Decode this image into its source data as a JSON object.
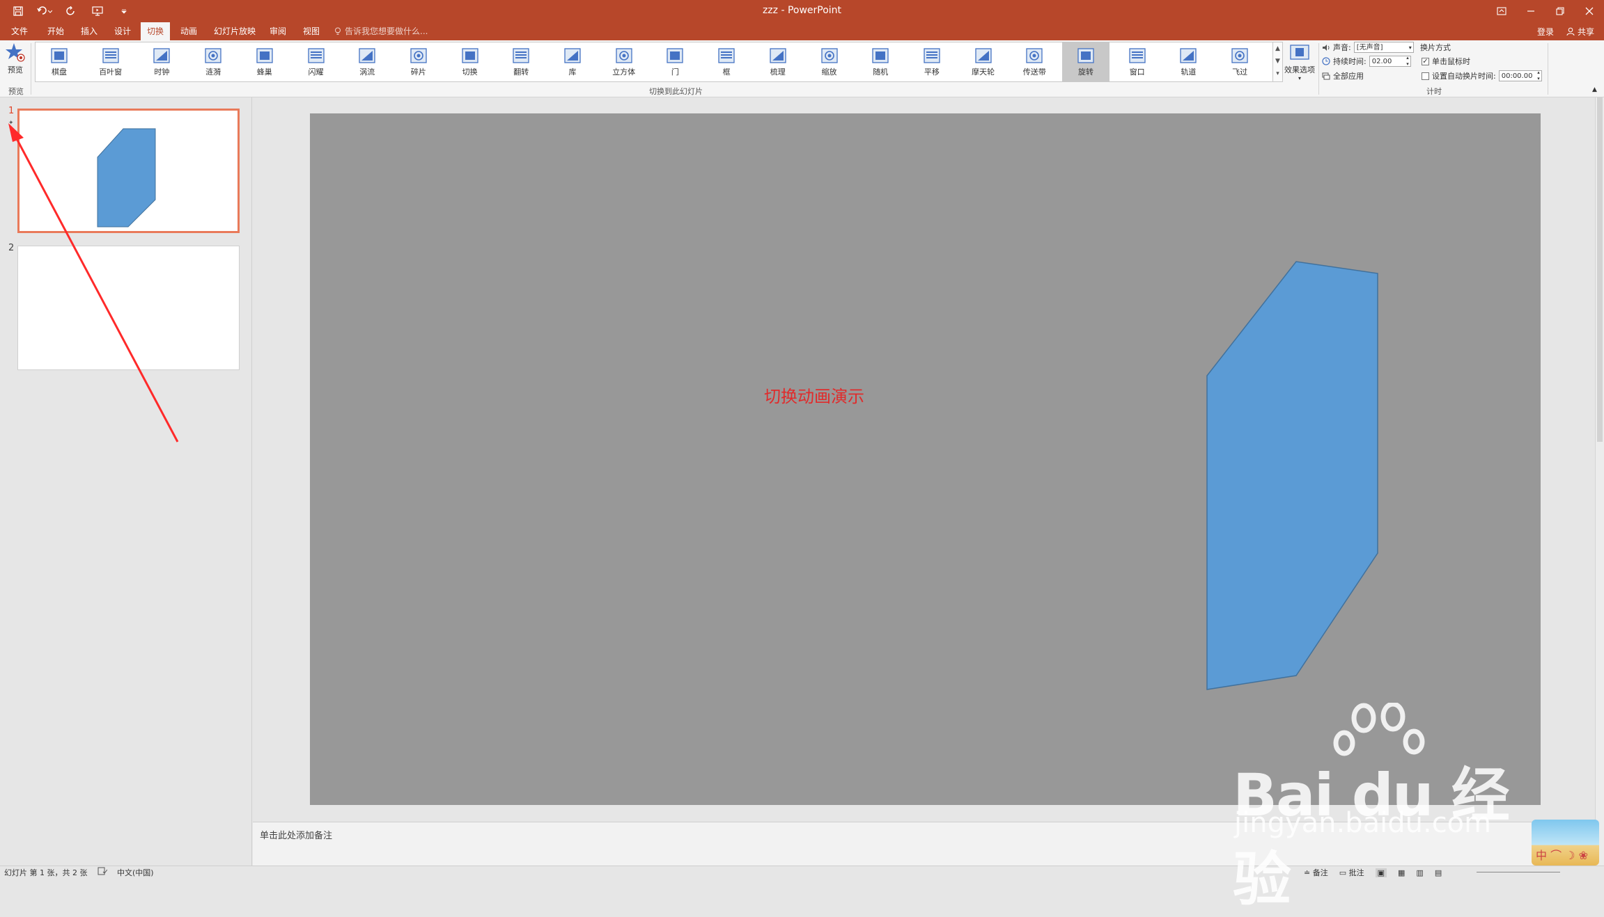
{
  "window": {
    "title": "zzz - PowerPoint",
    "qat_icons": [
      "save-icon",
      "undo-icon",
      "redo-icon",
      "present-from-beginning-icon",
      "customize-qat-icon"
    ],
    "controls": [
      "ribbon-display-options-icon",
      "minimize-icon",
      "restore-icon",
      "close-icon"
    ]
  },
  "tabs": [
    {
      "label": "文件",
      "active": false
    },
    {
      "label": "开始",
      "active": false
    },
    {
      "label": "插入",
      "active": false
    },
    {
      "label": "设计",
      "active": false
    },
    {
      "label": "切换",
      "active": true
    },
    {
      "label": "动画",
      "active": false
    },
    {
      "label": "幻灯片放映",
      "active": false
    },
    {
      "label": "审阅",
      "active": false
    },
    {
      "label": "视图",
      "active": false
    }
  ],
  "tell_me": "告诉我您想要做什么...",
  "account": {
    "signin": "登录",
    "share": "共享"
  },
  "ribbon": {
    "preview_label": "预览",
    "preview_group": "预览",
    "transitions_group": "切换到此幻灯片",
    "transitions": [
      {
        "label": "棋盘",
        "icon": "checkerboard-icon"
      },
      {
        "label": "百叶窗",
        "icon": "blinds-icon"
      },
      {
        "label": "时钟",
        "icon": "clock-icon"
      },
      {
        "label": "涟漪",
        "icon": "ripple-icon"
      },
      {
        "label": "蜂巢",
        "icon": "honeycomb-icon"
      },
      {
        "label": "闪耀",
        "icon": "glitter-icon"
      },
      {
        "label": "涡流",
        "icon": "vortex-icon"
      },
      {
        "label": "碎片",
        "icon": "shred-icon"
      },
      {
        "label": "切换",
        "icon": "switch-icon"
      },
      {
        "label": "翻转",
        "icon": "flip-icon"
      },
      {
        "label": "库",
        "icon": "gallery-icon"
      },
      {
        "label": "立方体",
        "icon": "cube-icon"
      },
      {
        "label": "门",
        "icon": "doors-icon"
      },
      {
        "label": "框",
        "icon": "box-icon"
      },
      {
        "label": "梳理",
        "icon": "comb-icon"
      },
      {
        "label": "缩放",
        "icon": "zoom-icon"
      },
      {
        "label": "随机",
        "icon": "random-icon"
      },
      {
        "label": "平移",
        "icon": "pan-icon"
      },
      {
        "label": "摩天轮",
        "icon": "ferris-wheel-icon"
      },
      {
        "label": "传送带",
        "icon": "conveyor-icon"
      },
      {
        "label": "旋转",
        "icon": "rotate-icon",
        "selected": true
      },
      {
        "label": "窗口",
        "icon": "window-icon"
      },
      {
        "label": "轨道",
        "icon": "orbit-icon"
      },
      {
        "label": "飞过",
        "icon": "fly-through-icon"
      }
    ],
    "effect_options_label": "效果选项",
    "timing_group": "计时",
    "sound_label": "声音:",
    "sound_value": "[无声音]",
    "duration_label": "持续时间:",
    "duration_value": "02.00",
    "apply_all_label": "全部应用",
    "advance_label": "换片方式",
    "on_click_label": "单击鼠标时",
    "on_click_checked": true,
    "after_label": "设置自动换片时间:",
    "after_value": "00:00.00",
    "after_checked": false
  },
  "slides": [
    {
      "number": "1",
      "has_transition_icon": true,
      "selected": true
    },
    {
      "number": "2",
      "has_transition_icon": false,
      "selected": false
    }
  ],
  "slide": {
    "text": "切换动画演示",
    "text_color": "#e02b2b",
    "shape_color": "#5b9bd5",
    "background": "#989898"
  },
  "notes_placeholder": "单击此处添加备注",
  "status": {
    "slide_info": "幻灯片 第 1 张，共 2 张",
    "language": "中文(中国)",
    "notes": "备注",
    "comments": "批注"
  },
  "watermark": {
    "logo": "Bai du 经验",
    "url": "jingyan.baidu.com"
  },
  "colors": {
    "accent": "#b7472a",
    "selection_border": "#e97a5a",
    "arrow": "#ff2a2a"
  }
}
